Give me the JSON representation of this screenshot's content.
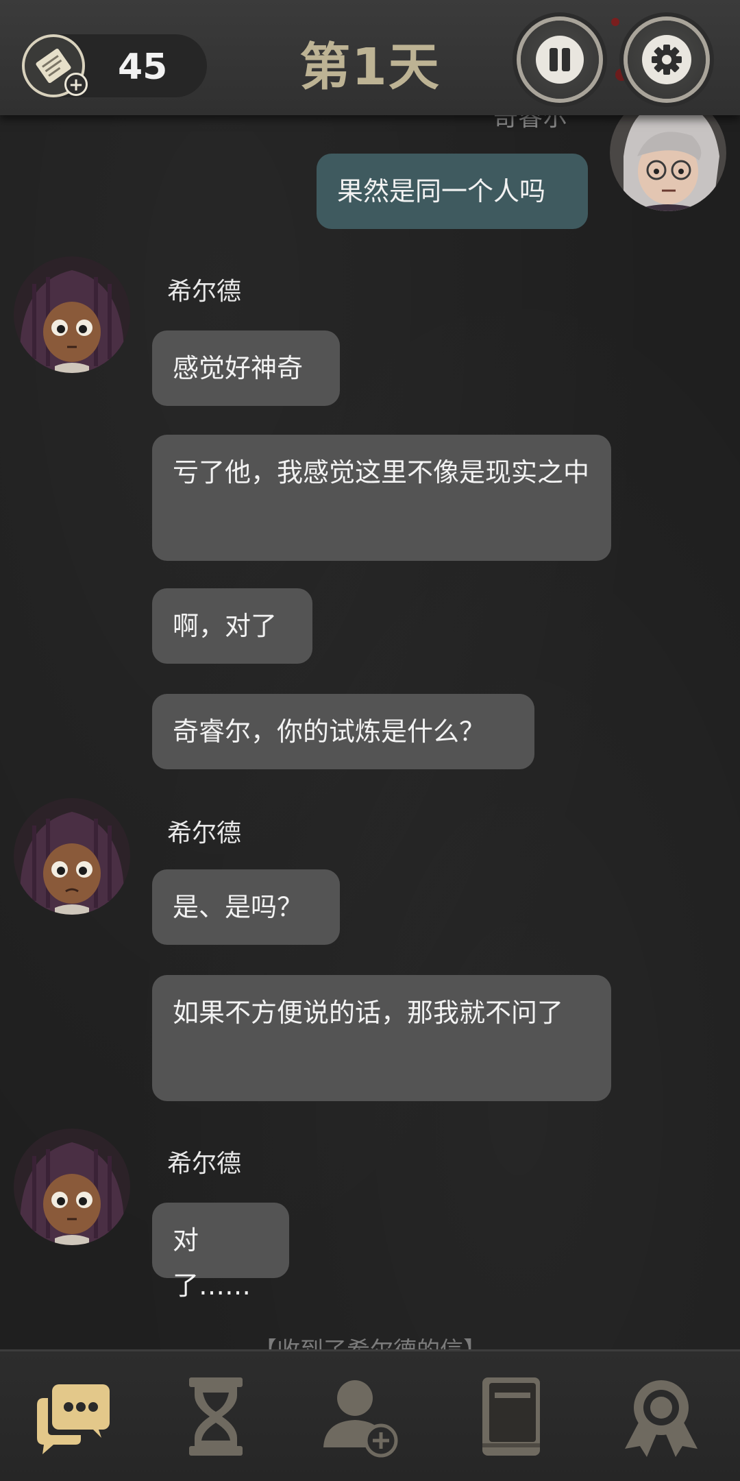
{
  "header": {
    "ticket_count": "45",
    "ticket_plus": "+",
    "day_title": "第1天"
  },
  "chat": {
    "top_partial_name": "奇睿尔",
    "my_message": "果然是同一个人吗",
    "groups": [
      {
        "speaker": "希尔德",
        "messages": [
          "感觉好神奇",
          "亏了他，我感觉这里不像是现实之中",
          "啊，对了",
          "奇睿尔，你的试炼是什么？"
        ]
      },
      {
        "speaker": "希尔德",
        "messages": [
          "是、是吗？",
          "如果不方便说的话，那我就不问了"
        ]
      },
      {
        "speaker": "希尔德",
        "messages": [
          "对了……"
        ]
      }
    ]
  },
  "notice": "【收到了希尔德的信】",
  "nav": {
    "items": [
      "chat-icon",
      "hourglass-icon",
      "add-friend-icon",
      "book-icon",
      "achievement-icon"
    ],
    "active_color": "#e3c88a",
    "inactive_color": "#6f6a60"
  }
}
